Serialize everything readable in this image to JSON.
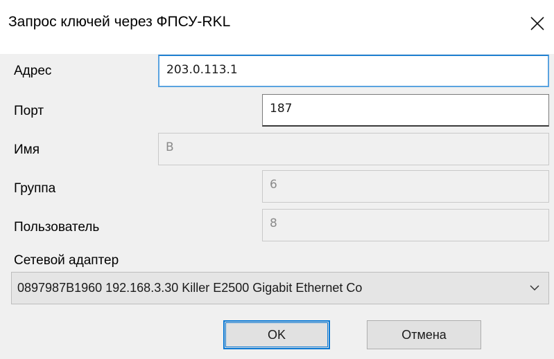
{
  "window": {
    "title": "Запрос ключей через ФПСУ-RKL"
  },
  "form": {
    "address": {
      "label": "Адрес",
      "value": "203.0.113.1"
    },
    "port": {
      "label": "Порт",
      "value": "187"
    },
    "name": {
      "label": "Имя",
      "value": "B"
    },
    "group": {
      "label": "Группа",
      "value": "6"
    },
    "user": {
      "label": "Пользователь",
      "value": "8"
    },
    "adapter": {
      "label": "Сетевой адаптер",
      "selected": "0897987B1960 192.168.3.30 Killer E2500 Gigabit Ethernet Co"
    }
  },
  "buttons": {
    "ok": "OK",
    "cancel": "Отмена"
  },
  "icons": {
    "close": "close-icon",
    "dropdown": "chevron-down-icon"
  },
  "colors": {
    "accent": "#0a78d4"
  }
}
